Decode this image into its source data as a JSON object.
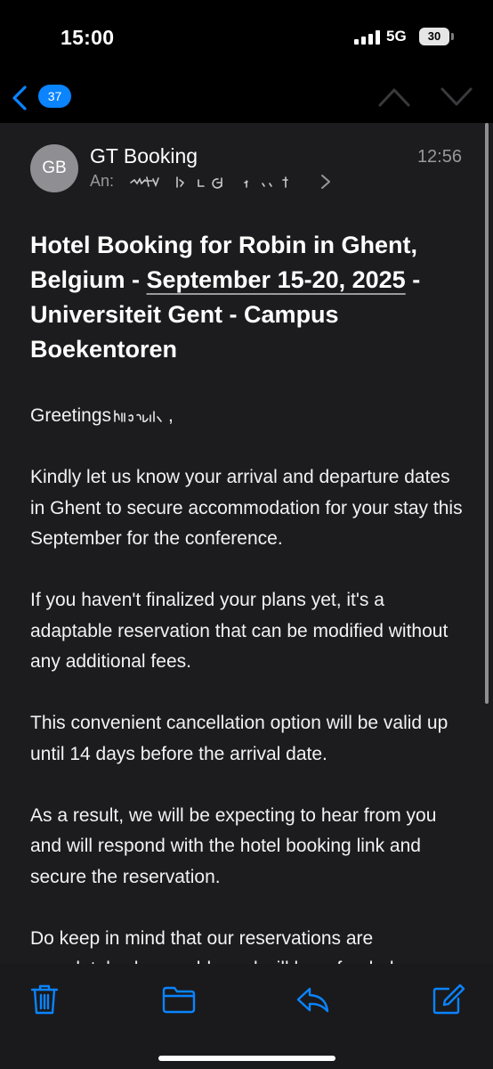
{
  "status_bar": {
    "time": "15:00",
    "network": "5G",
    "battery": "30"
  },
  "nav": {
    "back_count": "37",
    "icons": [
      "back-chevron-icon",
      "up-chevron-icon",
      "down-chevron-icon"
    ]
  },
  "mail": {
    "avatar_initials": "GB",
    "sender": "GT Booking",
    "to_label": "An:",
    "time": "12:56",
    "subject_prefix": "Hotel Booking for Robin in Ghent, Belgium - ",
    "subject_date": "September 15-20, 2025",
    "subject_suffix": " - Universiteit Gent - Campus Boekentoren",
    "greeting": "Greetings",
    "greeting_comma": ",",
    "paragraphs": [
      "Kindly let us know your arrival and departure dates in Ghent to secure accommodation for your stay this September for the conference.",
      "If you haven't finalized your plans yet, it's a adaptable reservation that can be modified without any additional fees.",
      "This convenient cancellation option will be valid up until 14 days before the arrival date.",
      "As a result, we will be expecting to hear from you and will respond with the hotel booking link and secure the reservation.",
      "Do keep in mind that our reservations are completely changeable and will be refunded"
    ]
  },
  "toolbar": {
    "icons": [
      "trash-icon",
      "folder-icon",
      "reply-icon",
      "compose-icon"
    ]
  },
  "colors": {
    "accent": "#0a84ff",
    "background": "#1c1c1e",
    "secondary_text": "#98989d"
  }
}
